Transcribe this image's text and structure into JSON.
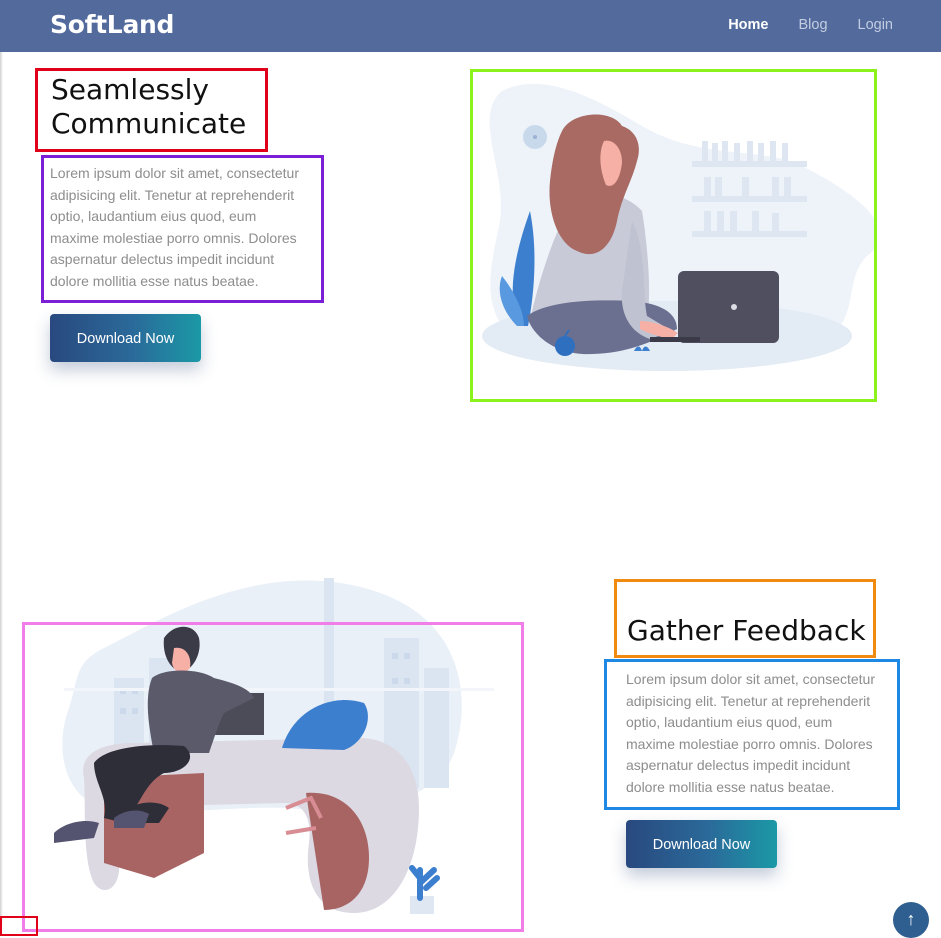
{
  "header": {
    "brand": "SoftLand",
    "nav": [
      {
        "label": "Home",
        "active": true
      },
      {
        "label": "Blog",
        "active": false
      },
      {
        "label": "Login",
        "active": false
      }
    ]
  },
  "section1": {
    "title_line1": "Seamlessly",
    "title_line2": "Communicate",
    "paragraph_lines": [
      "Lorem ipsum dolor sit amet, consectetur",
      "adipisicing elit. Tenetur at reprehenderit",
      "optio, laudantium eius quod, eum",
      "maxime molestiae porro omnis. Dolores",
      "aspernatur delectus impedit incidunt",
      "dolore mollitia esse natus beatae."
    ],
    "button_label": "Download Now"
  },
  "section2": {
    "title": "Gather Feedback",
    "paragraph_lines": [
      "Lorem ipsum dolor sit amet, consectetur",
      "adipisicing elit. Tenetur at reprehenderit",
      "optio, laudantium eius quod, eum",
      "maxime molestiae porro omnis. Dolores",
      "aspernatur delectus impedit incidunt",
      "dolore mollitia esse natus beatae."
    ],
    "button_label": "Download Now"
  },
  "icons": {
    "back_to_top": "arrow-up-icon"
  },
  "colors": {
    "navbar": "#536a9c",
    "button_gradient_start": "#29497f",
    "button_gradient_end": "#1b99a6",
    "annotation_title1": "#e0001a",
    "annotation_para1": "#7a1fd6",
    "annotation_image1": "#8cf21b",
    "annotation_title2": "#f08a10",
    "annotation_para2": "#1e88e5",
    "annotation_image2": "#f07de8"
  },
  "back_to_top_glyph": "↑"
}
